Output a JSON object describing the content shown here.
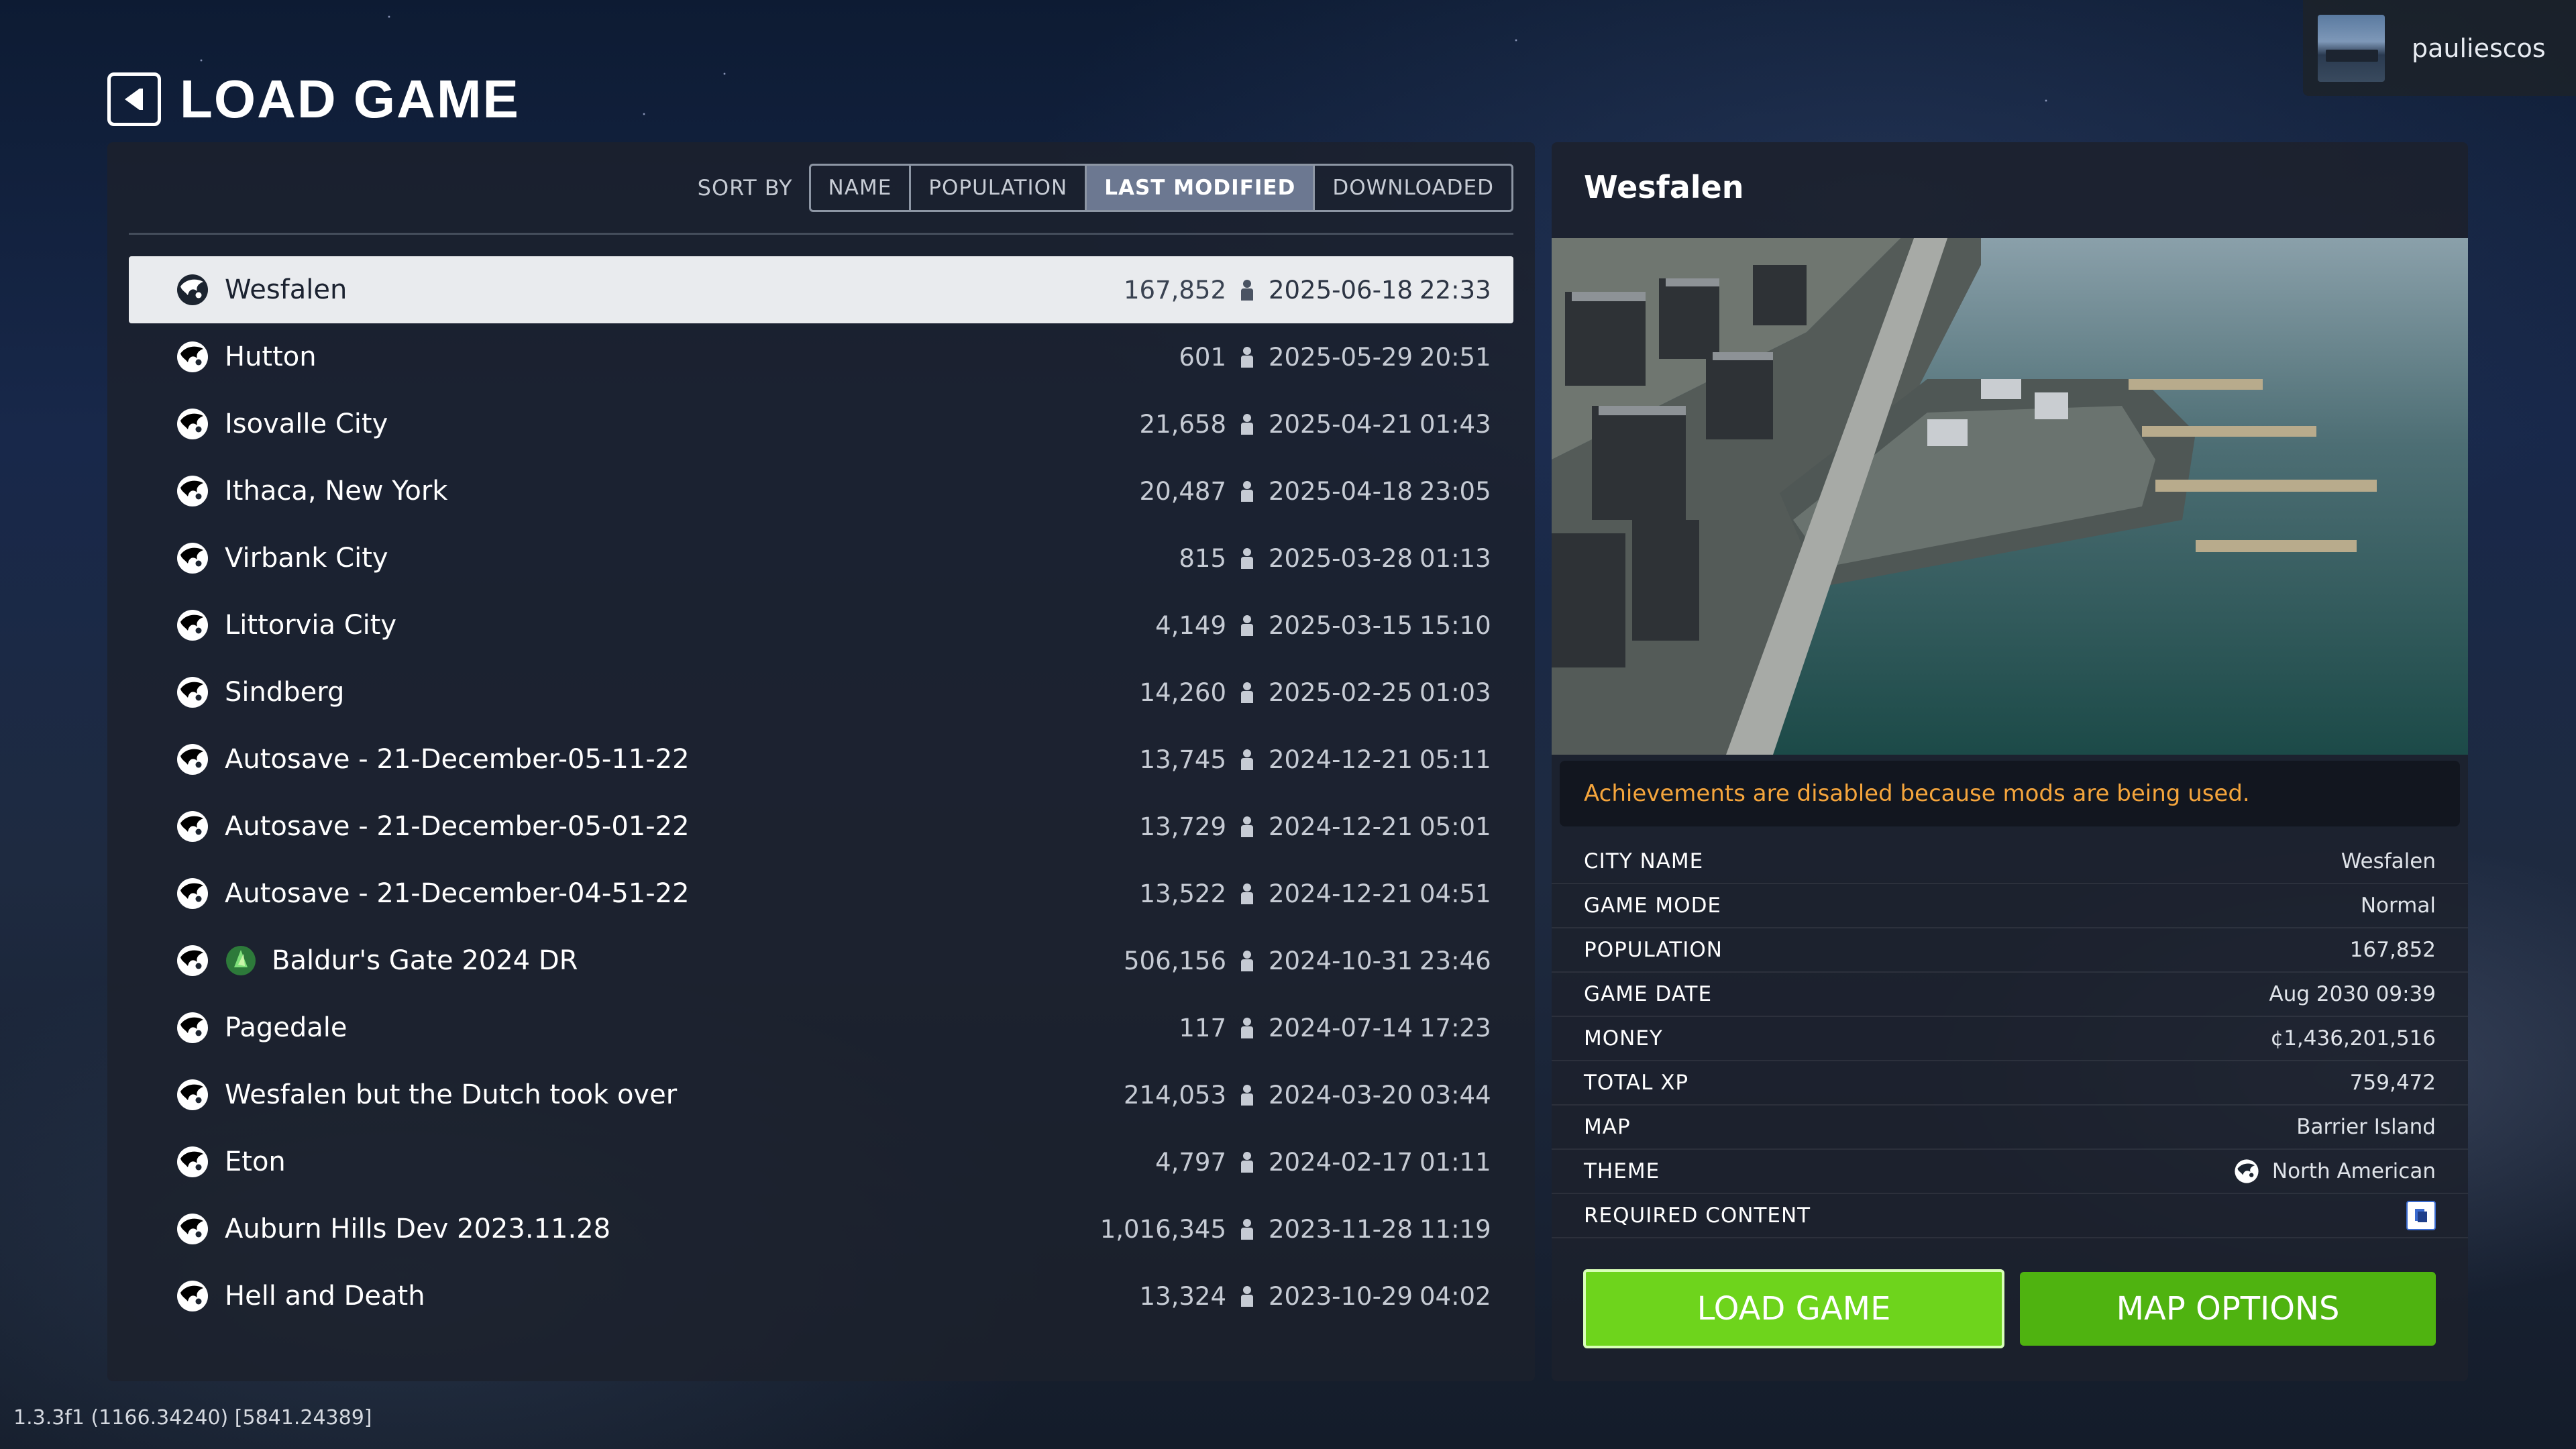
{
  "header": {
    "title": "LOAD GAME",
    "back_icon": "back-arrow-icon"
  },
  "user": {
    "name": "pauliescos"
  },
  "sort": {
    "label": "SORT BY",
    "options": [
      "NAME",
      "POPULATION",
      "LAST MODIFIED",
      "DOWNLOADED"
    ],
    "active": "LAST MODIFIED"
  },
  "saves": [
    {
      "name": "Wesfalen",
      "population": "167,852",
      "date": "2025-06-18",
      "time": "22:33"
    },
    {
      "name": "Hutton",
      "population": "601",
      "date": "2025-05-29",
      "time": "20:51"
    },
    {
      "name": "Isovalle City",
      "population": "21,658",
      "date": "2025-04-21",
      "time": "01:43"
    },
    {
      "name": "Ithaca, New York",
      "population": "20,487",
      "date": "2025-04-18",
      "time": "23:05"
    },
    {
      "name": "Virbank City",
      "population": "815",
      "date": "2025-03-28",
      "time": "01:13"
    },
    {
      "name": "Littorvia City",
      "population": "4,149",
      "date": "2025-03-15",
      "time": "15:10"
    },
    {
      "name": "Sindberg",
      "population": "14,260",
      "date": "2025-02-25",
      "time": "01:03"
    },
    {
      "name": "Autosave - 21-December-05-11-22",
      "population": "13,745",
      "date": "2024-12-21",
      "time": "05:11"
    },
    {
      "name": "Autosave - 21-December-05-01-22",
      "population": "13,729",
      "date": "2024-12-21",
      "time": "05:01"
    },
    {
      "name": "Autosave - 21-December-04-51-22",
      "population": "13,522",
      "date": "2024-12-21",
      "time": "04:51"
    },
    {
      "name": "Baldur's Gate 2024 DR",
      "population": "506,156",
      "date": "2024-10-31",
      "time": "23:46"
    },
    {
      "name": "Pagedale",
      "population": "117",
      "date": "2024-07-14",
      "time": "17:23"
    },
    {
      "name": "Wesfalen but the Dutch took over",
      "population": "214,053",
      "date": "2024-03-20",
      "time": "03:44"
    },
    {
      "name": "Eton",
      "population": "4,797",
      "date": "2024-02-17",
      "time": "01:11"
    },
    {
      "name": "Auburn Hills Dev 2023.11.28",
      "population": "1,016,345",
      "date": "2023-11-28",
      "time": "11:19"
    },
    {
      "name": "Hell and Death",
      "population": "13,324",
      "date": "2023-10-29",
      "time": "04:02"
    }
  ],
  "details": {
    "title": "Wesfalen",
    "warning": "Achievements are disabled because mods are being used.",
    "rows": [
      {
        "label": "CITY NAME",
        "value": "Wesfalen"
      },
      {
        "label": "GAME MODE",
        "value": "Normal"
      },
      {
        "label": "POPULATION",
        "value": "167,852"
      },
      {
        "label": "GAME DATE",
        "value": "Aug 2030 09:39"
      },
      {
        "label": "MONEY",
        "value": "¢1,436,201,516"
      },
      {
        "label": "TOTAL XP",
        "value": "759,472"
      },
      {
        "label": "MAP",
        "value": "Barrier Island"
      },
      {
        "label": "THEME",
        "value": "North American"
      },
      {
        "label": "REQUIRED CONTENT",
        "value": ""
      }
    ],
    "load_button": "LOAD GAME",
    "map_options_button": "MAP OPTIONS"
  },
  "version": "1.3.3f1 (1166.34240) [5841.24389]",
  "colors": {
    "accent_green": "#6ed41c",
    "accent_green_dark": "#4fb310",
    "warning_orange": "#f5a53c",
    "selected_row": "#e9ebee"
  }
}
